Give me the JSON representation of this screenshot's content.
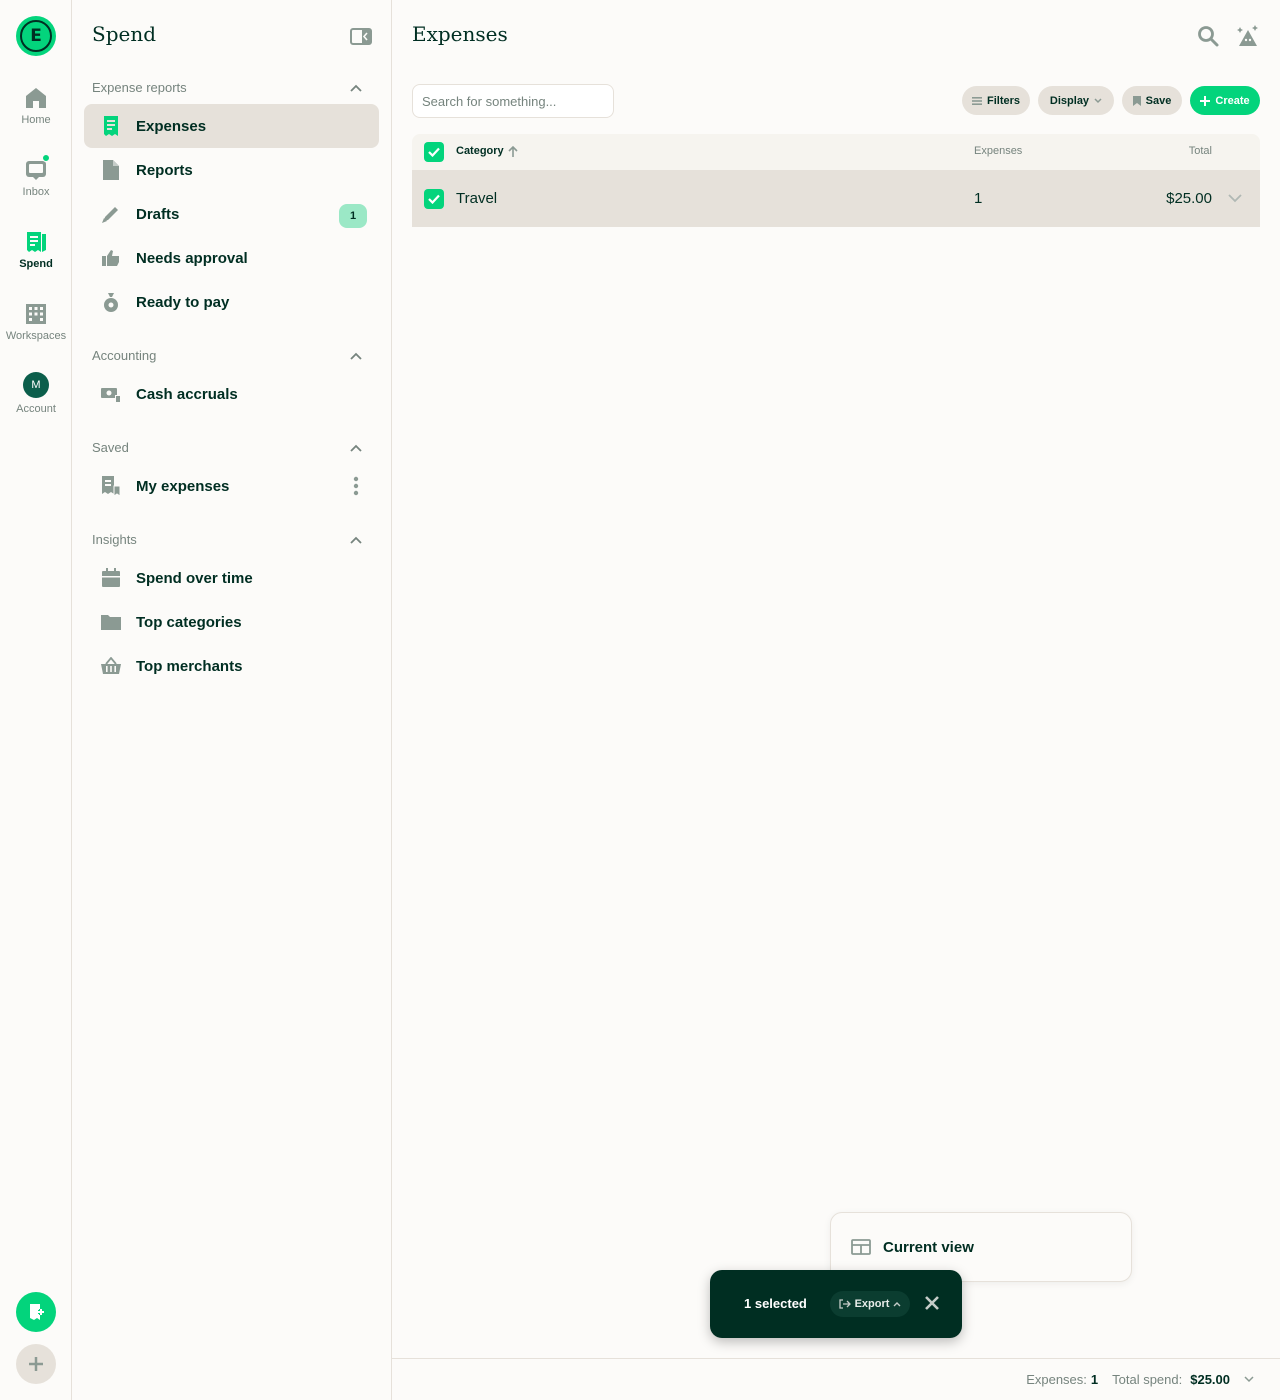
{
  "rail": {
    "items": [
      {
        "label": "Home",
        "icon": "home-icon"
      },
      {
        "label": "Inbox",
        "icon": "inbox-icon"
      },
      {
        "label": "Spend",
        "icon": "receipt-icon"
      },
      {
        "label": "Workspaces",
        "icon": "building-icon"
      },
      {
        "label": "Account",
        "icon": "avatar"
      }
    ],
    "avatar_initial": "M"
  },
  "sidebar": {
    "title": "Spend",
    "sections": [
      {
        "header": "Expense reports",
        "items": [
          {
            "label": "Expenses",
            "icon": "receipt-icon"
          },
          {
            "label": "Reports",
            "icon": "document-icon"
          },
          {
            "label": "Drafts",
            "icon": "pencil-icon",
            "badge": "1"
          },
          {
            "label": "Needs approval",
            "icon": "thumbs-up-icon"
          },
          {
            "label": "Ready to pay",
            "icon": "money-bag-icon"
          }
        ]
      },
      {
        "header": "Accounting",
        "items": [
          {
            "label": "Cash accruals",
            "icon": "cash-icon"
          }
        ]
      },
      {
        "header": "Saved",
        "items": [
          {
            "label": "My expenses",
            "icon": "bookmark-receipt-icon"
          }
        ]
      },
      {
        "header": "Insights",
        "items": [
          {
            "label": "Spend over time",
            "icon": "calendar-icon"
          },
          {
            "label": "Top categories",
            "icon": "folder-icon"
          },
          {
            "label": "Top merchants",
            "icon": "basket-icon"
          }
        ]
      }
    ]
  },
  "main": {
    "title": "Expenses",
    "search_placeholder": "Search for something...",
    "buttons": {
      "filters": "Filters",
      "display": "Display",
      "save": "Save",
      "create": "Create"
    },
    "table": {
      "columns": [
        "Category",
        "Expenses",
        "Total"
      ],
      "rows": [
        {
          "category": "Travel",
          "expenses": "1",
          "total": "$25.00"
        }
      ]
    }
  },
  "footer": {
    "expenses_label": "Expenses:",
    "expenses_value": "1",
    "spend_label": "Total spend:",
    "spend_value": "$25.00"
  },
  "selection": {
    "count_label": "1 selected",
    "export_label": "Export",
    "menu_item": "Current view"
  },
  "colors": {
    "accent": "#03d47c",
    "text": "#002e22",
    "muted": "#76847e",
    "selected_bg": "#e6e1da",
    "bar_bg": "#002e22"
  }
}
